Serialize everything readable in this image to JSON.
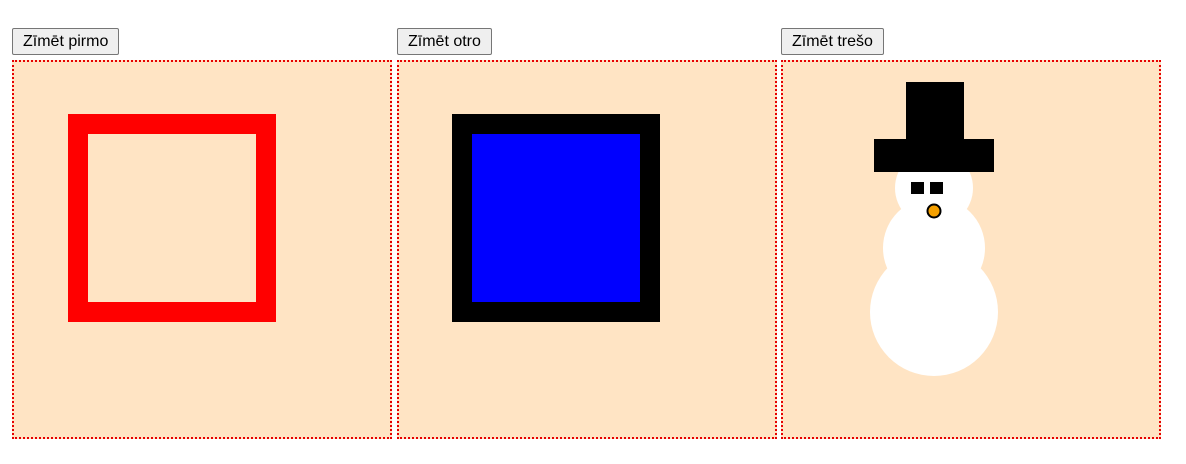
{
  "panels": [
    {
      "button_label": "Zīmēt pirmo",
      "drawing": "red-outlined-square"
    },
    {
      "button_label": "Zīmēt otro",
      "drawing": "blue-square-black-border"
    },
    {
      "button_label": "Zīmēt trešo",
      "drawing": "snowman-with-top-hat"
    }
  ],
  "colors": {
    "canvas_background": "#ffe4c4",
    "canvas_border": "#e60000",
    "square_outline_red": "#ff0000",
    "square_fill_blue": "#0000ff",
    "square_border_black": "#000000",
    "snowman_body": "#ffffff",
    "hat": "#000000",
    "nose": "#f5a000"
  }
}
